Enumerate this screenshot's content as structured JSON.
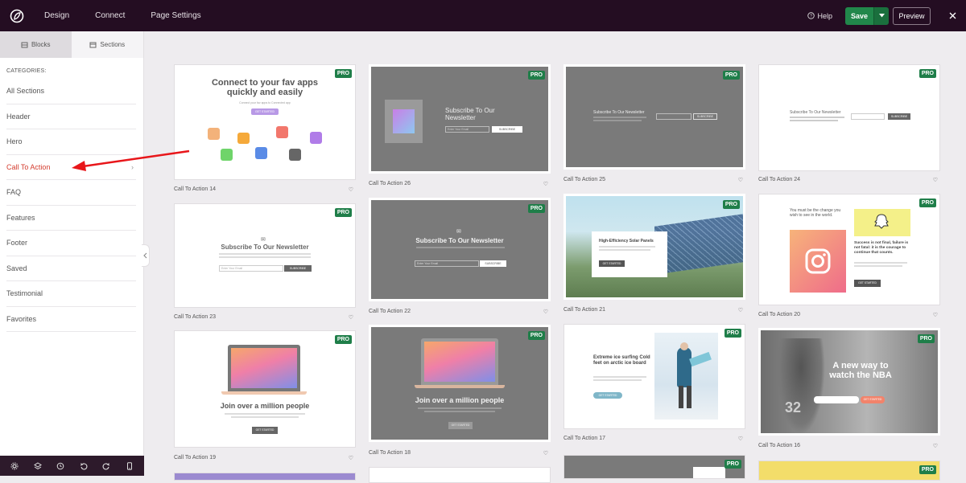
{
  "topbar": {
    "nav": [
      "Design",
      "Connect",
      "Page Settings"
    ],
    "help": "Help",
    "save": "Save",
    "preview": "Preview"
  },
  "sidebar": {
    "tabs": [
      "Blocks",
      "Sections"
    ],
    "categories_title": "CATEGORIES:",
    "items": [
      "All Sections",
      "Header",
      "Hero",
      "Call To Action",
      "FAQ",
      "Features",
      "Footer",
      "Saved",
      "Testimonial",
      "Favorites"
    ],
    "active": "Call To Action"
  },
  "badge": "PRO",
  "cards": [
    {
      "caption": "Call To Action 14",
      "title": "Connect to your fav apps quickly and easily",
      "subtitle": "Connect your fav apps to Connected app",
      "button": "GET STARTED"
    },
    {
      "caption": "Call To Action 26",
      "title": "Subscribe To Our Newsletter",
      "placeholder": "Enter Your Email",
      "button": "SUBSCRIBE"
    },
    {
      "caption": "Call To Action 25",
      "title": "Subscribe To Our Newsletter",
      "button": "SUBSCRIBE"
    },
    {
      "caption": "Call To Action 24",
      "title": "Subscribe To Our Newsletter",
      "button": "SUBSCRIBE"
    },
    {
      "caption": "Call To Action 23",
      "title": "Subscribe To Our Newsletter",
      "placeholder": "Enter Your Email",
      "button": "SUBSCRIBE"
    },
    {
      "caption": "Call To Action 22",
      "title": "Subscribe To Our Newsletter",
      "placeholder": "Enter Your Email",
      "button": "SUBSCRIBE"
    },
    {
      "caption": "Call To Action 21",
      "title": "High-Efficiency Solar Panels",
      "button": "GET STARTED"
    },
    {
      "caption": "Call To Action 20",
      "title": "You must be the change you wish to see in the world.",
      "quote": "Success is not final, failure is not fatal: it is the courage to continue that counts.",
      "button": "GET STARTED"
    },
    {
      "caption": "Call To Action 19",
      "title": "Join over a million people",
      "button": "GET STARTED"
    },
    {
      "caption": "Call To Action 18",
      "title": "Join over a million people",
      "button": "GET STARTED"
    },
    {
      "caption": "Call To Action 17",
      "title": "Extreme ice surfing Cold feet on arctic ice board",
      "button": "GET STARTED"
    },
    {
      "caption": "Call To Action 16",
      "title": "A new way to watch the NBA",
      "button": "GET STARTED"
    }
  ],
  "colors": {
    "topbar": "#240d22",
    "accent_green": "#21874b",
    "active_red": "#d43d2f",
    "arrow": "#e8161a"
  }
}
